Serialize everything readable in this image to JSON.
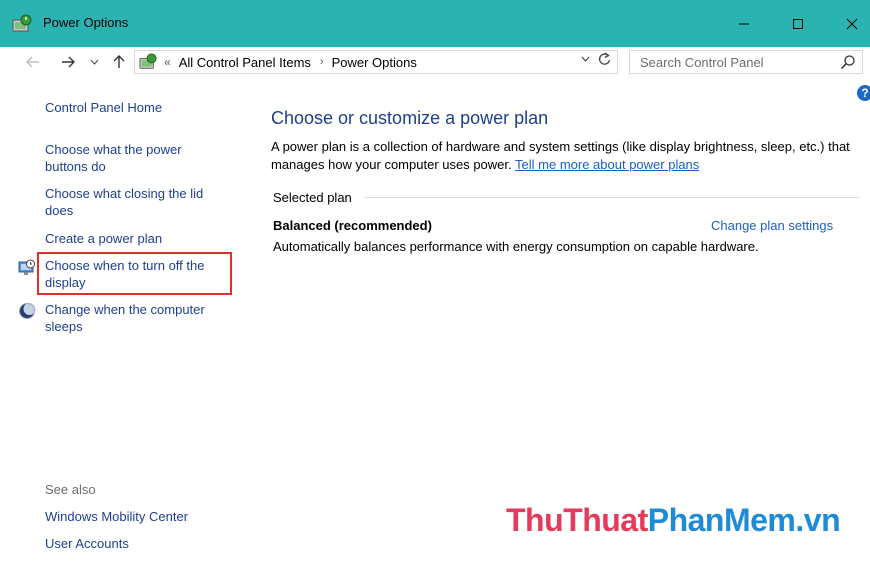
{
  "window": {
    "title": "Power Options",
    "icon": "power-options-icon",
    "controls": [
      "minimize-icon",
      "maximize-icon",
      "close-icon"
    ]
  },
  "navigation": {
    "path": [
      "All Control Panel Items",
      "Power Options"
    ],
    "path_prefix": "«",
    "separator": "›",
    "search_placeholder": "Search Control Panel"
  },
  "sidebar": {
    "home": "Control Panel Home",
    "links": [
      {
        "label": "Choose what the power buttons do",
        "icon": null
      },
      {
        "label": "Choose what closing the lid does",
        "icon": null
      },
      {
        "label": "Create a power plan",
        "icon": null
      },
      {
        "label": "Choose when to turn off the display",
        "icon": "display-timer-icon",
        "highlighted": true
      },
      {
        "label": "Change when the computer sleeps",
        "icon": "sleep-moon-icon"
      }
    ],
    "see_also_title": "See also",
    "see_also": [
      "Windows Mobility Center",
      "User Accounts"
    ]
  },
  "main": {
    "heading": "Choose or customize a power plan",
    "description": "A power plan is a collection of hardware and system settings (like display brightness, sleep, etc.) that manages how your computer uses power.",
    "learn_more": "Tell me more about power plans",
    "selected_plan_label": "Selected plan",
    "plan": {
      "name": "Balanced (recommended)",
      "change_link": "Change plan settings",
      "description": "Automatically balances performance with energy consumption on capable hardware."
    },
    "help": "?"
  },
  "watermark": {
    "part1": "ThuThuat",
    "part2": "PhanMem.vn"
  },
  "colors": {
    "titlebar": "#2ab3b1",
    "link": "#1e3f8f",
    "highlight_box": "#e0302e"
  }
}
